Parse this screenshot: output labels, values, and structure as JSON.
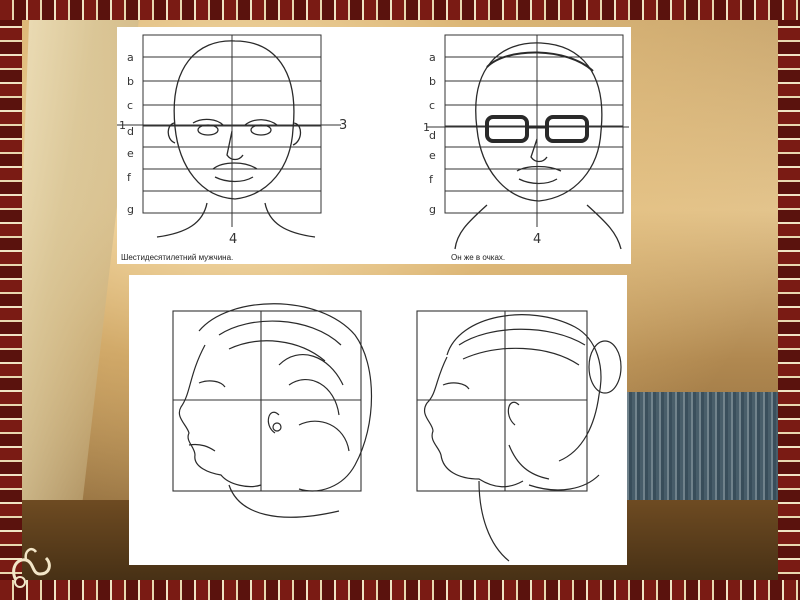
{
  "slide": {
    "top_left_caption": "Шестидесятилетний мужчина.",
    "top_right_caption": "Он же в очках."
  },
  "grid_labels": {
    "rows": [
      "a",
      "b",
      "c",
      "d",
      "e",
      "f",
      "g"
    ],
    "left_marker": "1",
    "right_marker": "3",
    "bottom_marker": "4"
  },
  "colors": {
    "frame_red": "#7a1b14",
    "panel": "#ffffff",
    "pencil": "#2a2a2a"
  }
}
